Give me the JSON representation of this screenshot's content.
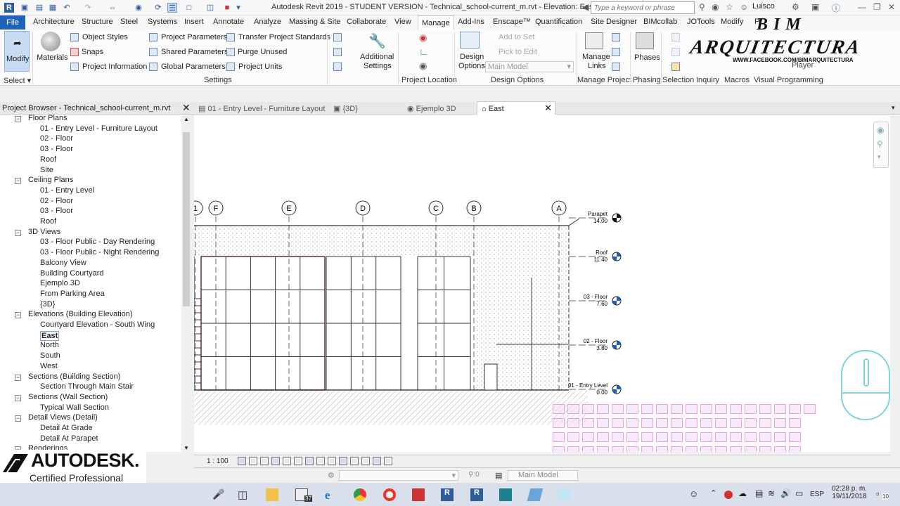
{
  "titlebar": {
    "title": "Autodesk Revit 2019 - STUDENT VERSION - Technical_school-current_m.rvt - Elevation: East",
    "search_placeholder": "Type a keyword or phrase",
    "user": "Luisco"
  },
  "tabs": [
    "File",
    "Architecture",
    "Structure",
    "Steel",
    "Systems",
    "Insert",
    "Annotate",
    "Analyze",
    "Massing & Site",
    "Collaborate",
    "View",
    "Manage",
    "Add-Ins",
    "Enscape™",
    "Quantification",
    "Site Designer",
    "BIMcollab",
    "JOTools",
    "Modify",
    "Pr"
  ],
  "ribbon": {
    "modify": "Modify",
    "materials": "Materials",
    "settings": [
      "Object  Styles",
      "Snaps",
      "Project  Information",
      "Project  Parameters",
      "Shared  Parameters",
      "Global  Parameters",
      "Transfer  Project Standards",
      "Purge  Unused",
      "Project  Units"
    ],
    "additional": [
      "Additional",
      "Settings"
    ],
    "design_options": [
      "Design",
      "Options"
    ],
    "main_model": "Main Model",
    "add_to_set": "Add to Set",
    "pick_to_edit": "Pick to Edit",
    "manage_links": [
      "Manage",
      "Links"
    ],
    "phases": "Phases",
    "player": "Player",
    "groups": [
      "Select",
      "Settings",
      "Project Location",
      "Design Options",
      "Manage Project",
      "Phasing",
      "Selection",
      "Inquiry",
      "Macros",
      "Visual Programming"
    ]
  },
  "watermark": {
    "bim": "BIM",
    "arq": "ARQUITECTURA",
    "fb": "WWW.FACEBOOK.COM/BIMARQUITECTURA"
  },
  "browser": {
    "title": "Project Browser - Technical_school-current_m.rvt",
    "items": [
      {
        "t": "Floor Plans",
        "l": 0
      },
      {
        "t": "01 - Entry Level - Furniture Layout",
        "l": 1
      },
      {
        "t": "02 - Floor",
        "l": 1
      },
      {
        "t": "03 - Floor",
        "l": 1
      },
      {
        "t": "Roof",
        "l": 1
      },
      {
        "t": "Site",
        "l": 1
      },
      {
        "t": "Ceiling Plans",
        "l": 0
      },
      {
        "t": "01 - Entry Level",
        "l": 1
      },
      {
        "t": "02 - Floor",
        "l": 1
      },
      {
        "t": "03 - Floor",
        "l": 1
      },
      {
        "t": "Roof",
        "l": 1
      },
      {
        "t": "3D Views",
        "l": 0
      },
      {
        "t": "03 - Floor Public - Day Rendering",
        "l": 1
      },
      {
        "t": "03 - Floor Public - Night Rendering",
        "l": 1
      },
      {
        "t": "Balcony View",
        "l": 1
      },
      {
        "t": "Building Courtyard",
        "l": 1
      },
      {
        "t": "Ejemplo 3D",
        "l": 1
      },
      {
        "t": "From Parking Area",
        "l": 1
      },
      {
        "t": "{3D}",
        "l": 1
      },
      {
        "t": "Elevations (Building Elevation)",
        "l": 0
      },
      {
        "t": "Courtyard Elevation - South Wing",
        "l": 1
      },
      {
        "t": "East",
        "l": 1,
        "sel": true
      },
      {
        "t": "North",
        "l": 1
      },
      {
        "t": "South",
        "l": 1
      },
      {
        "t": "West",
        "l": 1
      },
      {
        "t": "Sections (Building Section)",
        "l": 0
      },
      {
        "t": "Section Through Main Stair",
        "l": 1
      },
      {
        "t": "Sections (Wall Section)",
        "l": 0
      },
      {
        "t": "Typical Wall Section",
        "l": 1
      },
      {
        "t": "Detail Views (Detail)",
        "l": 0
      },
      {
        "t": "Detail At Grade",
        "l": 1
      },
      {
        "t": "Detail At Parapet",
        "l": 1
      },
      {
        "t": "Renderings",
        "l": 0
      }
    ]
  },
  "view_tabs": [
    "01 - Entry Level - Furniture Layout",
    "{3D}",
    "Ejemplo 3D",
    "East"
  ],
  "grids": [
    "1",
    "F",
    "E",
    "D",
    "C",
    "B",
    "A"
  ],
  "levels": [
    {
      "name": "Parapet",
      "elev": "14.00"
    },
    {
      "name": "Roof",
      "elev": "11.40"
    },
    {
      "name": "03 - Floor",
      "elev": "7.60"
    },
    {
      "name": "02 - Floor",
      "elev": "3.80"
    },
    {
      "name": "01 - Entry Level",
      "elev": "0.00"
    }
  ],
  "scale": "1 : 100",
  "status": {
    "coord": ":0",
    "model": "Main Model"
  },
  "logo": {
    "brand": "AUTODESK.",
    "cert": "Certified Professional"
  },
  "taskbar": {
    "lang": "ESP",
    "time": "02:28 p. m.",
    "date": "19/11/2018",
    "mail": "37",
    "notif": "10"
  }
}
